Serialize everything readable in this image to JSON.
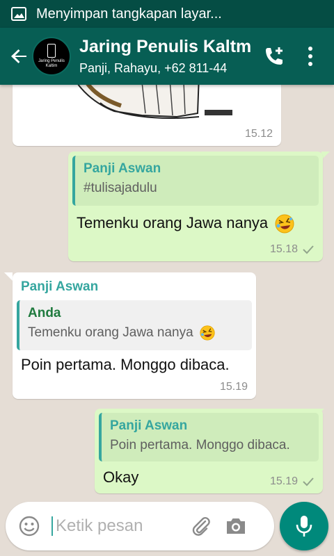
{
  "status_bar": {
    "text": "Menyimpan tangkapan layar...",
    "icon": "image-icon"
  },
  "header": {
    "title": "Jaring Penulis Kaltm",
    "subtitle": "Panji, Rahayu, +62 811-44",
    "avatar_text": "Jaring Penulis Kaltim",
    "back_icon": "back-arrow-icon",
    "call_icon": "add-call-icon",
    "menu_icon": "more-vert-icon"
  },
  "messages": [
    {
      "id": "m1",
      "direction": "in",
      "type": "image",
      "time": "15.12"
    },
    {
      "id": "m2",
      "direction": "out",
      "quote_name": "Panji Aswan",
      "quote_text": "#tulisajadulu",
      "text": "Temenku orang Jawa nanya",
      "emoji": "rolling-laughing-emoji",
      "time": "15.18",
      "status": "sent"
    },
    {
      "id": "m3",
      "direction": "in",
      "sender": "Panji Aswan",
      "quote_name": "Anda",
      "quote_text": "Temenku orang Jawa nanya",
      "quote_emoji": "rolling-laughing-emoji",
      "text": "Poin pertama. Monggo dibaca.",
      "time": "15.19"
    },
    {
      "id": "m4",
      "direction": "out",
      "quote_name": "Panji Aswan",
      "quote_text": "Poin pertama. Monggo dibaca.",
      "text": "Okay",
      "time": "15.19",
      "status": "sent"
    }
  ],
  "composer": {
    "placeholder": "Ketik pesan",
    "value": "",
    "emoji_icon": "smiley-icon",
    "attach_icon": "paperclip-icon",
    "camera_icon": "camera-icon",
    "mic_icon": "mic-icon"
  },
  "colors": {
    "header": "#075e54",
    "statusbar": "#054d44",
    "outgoing": "#dcf8c6",
    "incoming": "#ffffff",
    "accent": "#35a69f",
    "fab": "#00897b",
    "wallpaper": "#e5ddd5"
  }
}
